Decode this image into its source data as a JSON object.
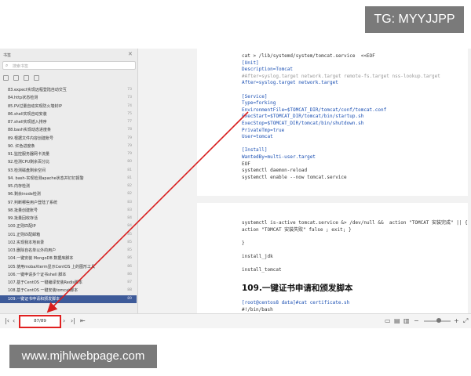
{
  "watermarks": {
    "top": "TG: MYYJJPP",
    "bottom": "www.mjhlwebpage.com"
  },
  "sidebar": {
    "title": "书签",
    "search_placeholder": "搜索书签",
    "items": [
      {
        "label": "83.expect实现远程登陆自动交互",
        "page": "73"
      },
      {
        "label": "84.http状态检测",
        "page": "73"
      },
      {
        "label": "85.PV过量自动实现防火墙封IP",
        "page": "74"
      },
      {
        "label": "86.shell实现自动安装",
        "page": "75"
      },
      {
        "label": "87.shell实现插入排序",
        "page": "77"
      },
      {
        "label": "88.bash实现动态进度条",
        "page": "78"
      },
      {
        "label": "89.根据文件内容创建账号",
        "page": "79"
      },
      {
        "label": "90. 红色进度条",
        "page": "79"
      },
      {
        "label": "91.监控服务器网卡流量",
        "page": "79"
      },
      {
        "label": "92.检测CPU剩余百分比",
        "page": "80"
      },
      {
        "label": "93.检测磁盘剩余空间",
        "page": "81"
      },
      {
        "label": "94. bash-实现检测apache状态并钉钉报警",
        "page": "81"
      },
      {
        "label": "95.内存检测",
        "page": "82"
      },
      {
        "label": "96.剩余inode检测",
        "page": "82"
      },
      {
        "label": "97.判断哪些用户登陆了系统",
        "page": "83"
      },
      {
        "label": "98.批量创建账号",
        "page": "83"
      },
      {
        "label": "99.批量回收存活",
        "page": "84"
      },
      {
        "label": "100.正则匹配IP",
        "page": "84"
      },
      {
        "label": "101.正则匹配邮箱",
        "page": "85"
      },
      {
        "label": "102.实现我本地目录",
        "page": "85"
      },
      {
        "label": "103.删除自名单以外的用户",
        "page": "85"
      },
      {
        "label": "104.一键安装 MongoDB 数据库脚本",
        "page": "86"
      },
      {
        "label": "105.使用mobaXterm显示CentOS 上的图形工具",
        "page": "86"
      },
      {
        "label": "106.一键申请多个证书shell 脚本",
        "page": "86"
      },
      {
        "label": "107.基于CentOS 一键编译安装Redis脚本",
        "page": "87"
      },
      {
        "label": "108.基于CentOS 一键安装tomcat脚本",
        "page": "88"
      },
      {
        "label": "109.一键证书申请和颁发脚本",
        "page": "89"
      }
    ]
  },
  "document": {
    "page1_code": [
      "cat > /lib/systemd/system/tomcat.service  <<EOF",
      "[Unit]",
      "Description=Tomcat",
      "#After=syslog.target network.target remote-fs.target nss-lookup.target",
      "After=syslog.target network.target",
      "",
      "[Service]",
      "Type=forking",
      "EnvironmentFile=$TOMCAT_DIR/tomcat/conf/tomcat.conf",
      "ExecStart=$TOMCAT_DIR/tomcat/bin/startup.sh",
      "ExecStop=$TOMCAT_DIR/tomcat/bin/shutdown.sh",
      "PrivateTmp=true",
      "User=tomcat",
      "",
      "[Install]",
      "WantedBy=multi-user.target",
      "EOF",
      "systemctl daemon-reload",
      "systemctl enable --now tomcat.service"
    ],
    "page2_code": [
      "systemctl is-active tomcat.service &> /dev/null &&  action \"TOMCAT 安装完成\" || {",
      "action \"TOMCAT 安装失败\" false ; exit; }",
      "",
      "}",
      "",
      "install_jdk",
      "",
      "install_tomcat"
    ],
    "section_title": "109.一键证书申请和颁发脚本",
    "page2_code2": [
      "[root@centos8 data]#cat certificate.sh",
      "#!/bin/bash"
    ]
  },
  "statusbar": {
    "page_indicator": "87/89"
  }
}
